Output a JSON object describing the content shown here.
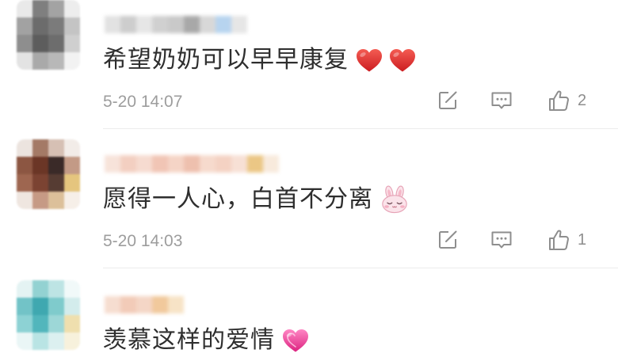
{
  "comments": [
    {
      "text": "希望奶奶可以早早康复",
      "emojis": [
        "red-heart-icon",
        "red-heart-icon"
      ],
      "time": "5-20 14:07",
      "likes": 2,
      "avatar_mosaic": [
        "#e9e9e9",
        "#7f7f7f",
        "#a3a3a3",
        "#ededed",
        "#a2a2a2",
        "#6c6c6c",
        "#7b7b7b",
        "#c4c4c4",
        "#8e8e8e",
        "#5d5d5d",
        "#6d6d6d",
        "#cfcfcf",
        "#e3e3e3",
        "#a9a9a9",
        "#b8b8b8",
        "#f2f2f2"
      ],
      "name_blur": [
        "#e2e2e2",
        "#cdcdcd",
        "#e6e6e6",
        "#d0d0d0",
        "#c9c9c9",
        "#a8a8a8",
        "#d8d8d8",
        "#b7d4ef",
        "#e6e6e6"
      ]
    },
    {
      "text": "愿得一人心，白首不分离",
      "emojis": [
        "bunny-face-icon"
      ],
      "time": "5-20 14:03",
      "likes": 1,
      "avatar_mosaic": [
        "#ece4df",
        "#a47a66",
        "#d6c0b4",
        "#f2ece8",
        "#8c5642",
        "#6b3626",
        "#3a2a28",
        "#c39a86",
        "#9e6650",
        "#7b4332",
        "#563c33",
        "#e5c57e",
        "#efe6e0",
        "#c69a85",
        "#dcc09a",
        "#f6efe8"
      ],
      "name_blur": [
        "#f7e3da",
        "#f3cfc1",
        "#f6dbd0",
        "#f1c5b5",
        "#f5d4c6",
        "#eec0ae",
        "#f6dacd",
        "#f4d2c3",
        "#f7e0d5",
        "#ebc785",
        "#f8eadc"
      ]
    },
    {
      "text": "羡慕这样的爱情",
      "emojis": [
        "pink-heart-icon"
      ],
      "avatar_mosaic": [
        "#e4f3f3",
        "#93d2d2",
        "#bde4e4",
        "#f1f9f9",
        "#72c3c7",
        "#3fa8b0",
        "#7fcbcc",
        "#d3ecec",
        "#8dd2d4",
        "#52b6bc",
        "#9dd7d7",
        "#efdfae",
        "#eaf6f6",
        "#b9e4e4",
        "#dcf0f0",
        "#f7f1dc"
      ],
      "name_blur": [
        "#f6ddd0",
        "#f2cbb8",
        "#f4d6c6",
        "#f1c99c",
        "#f7e3c6"
      ]
    }
  ],
  "actions": {
    "icons": [
      "edit-icon",
      "comment-icon",
      "thumbs-up-icon"
    ]
  },
  "colors": {
    "text": "#2e2e2e",
    "meta": "#9d9d9d",
    "icon": "#8e8e8e",
    "divider": "#ececec",
    "heart_red": "#e0302e",
    "heart_pink": "#e8409a"
  }
}
